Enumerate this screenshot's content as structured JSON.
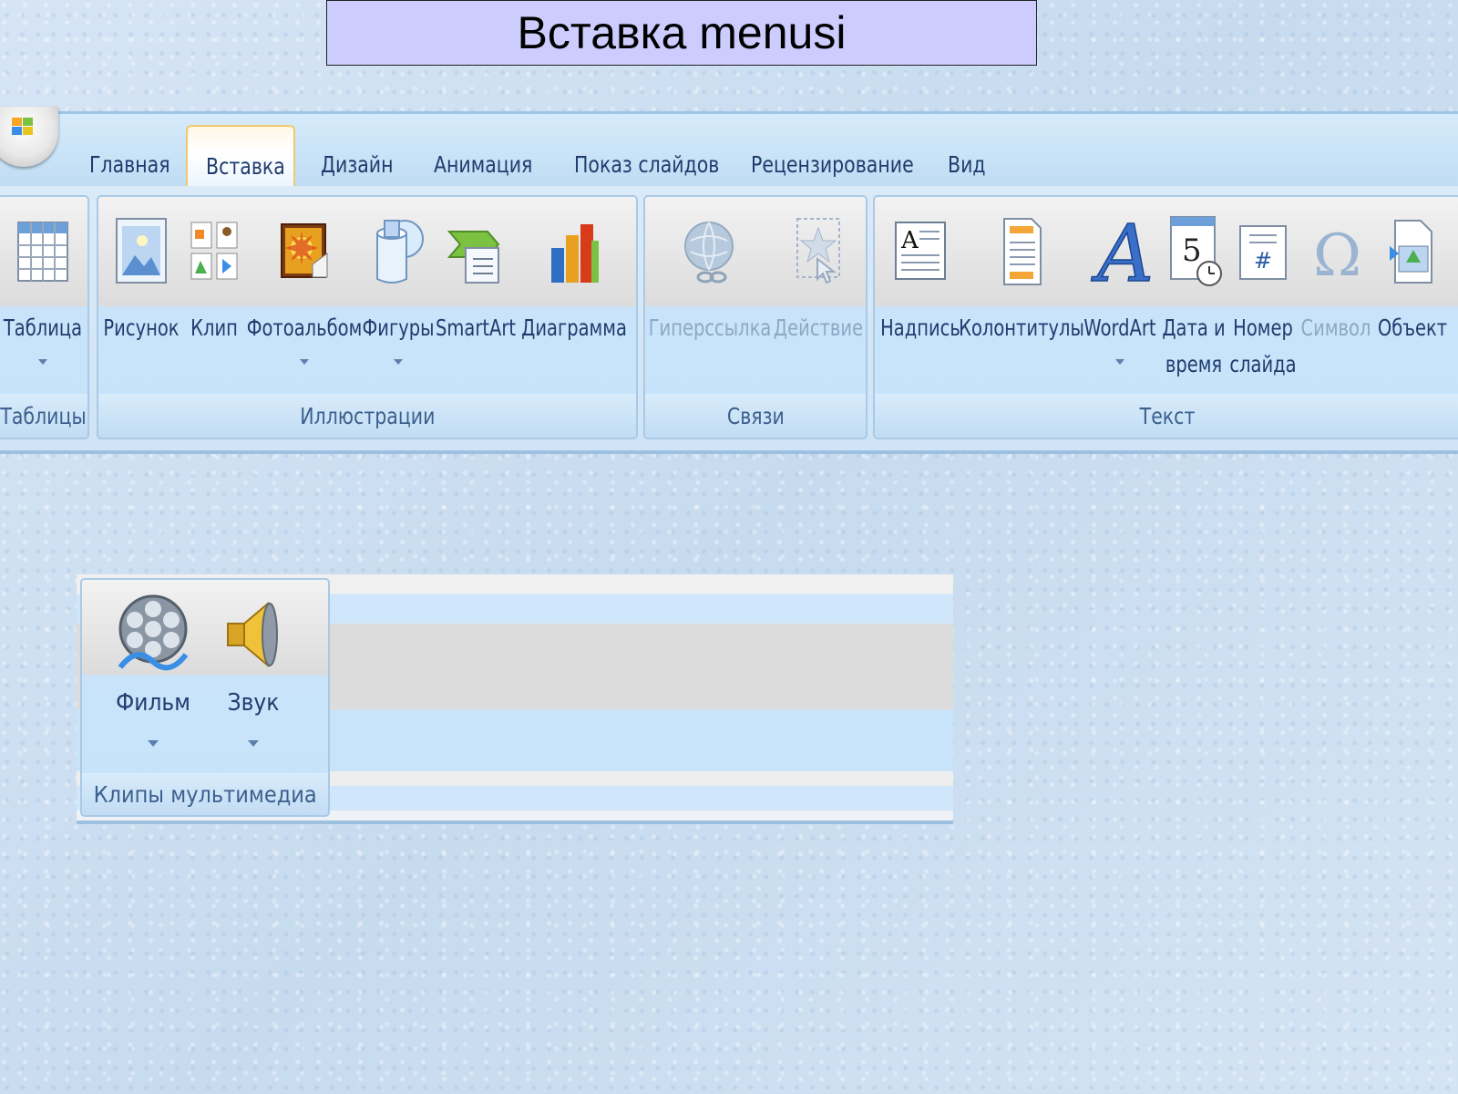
{
  "slide": {
    "title": "Вставка menusi"
  },
  "ribbon": {
    "tabs": [
      "Главная",
      "Вставка",
      "Дизайн",
      "Анимация",
      "Показ слайдов",
      "Рецензирование",
      "Вид"
    ],
    "active_tab": "Вставка",
    "groups": {
      "tables": {
        "label": "Таблицы",
        "buttons": [
          {
            "label": "Таблица",
            "icon": "table-icon",
            "has_dropdown": true
          }
        ]
      },
      "illustrations": {
        "label": "Иллюстрации",
        "buttons": [
          {
            "label": "Рисунок",
            "icon": "picture-icon",
            "has_dropdown": false
          },
          {
            "label": "Клип",
            "icon": "clipart-icon",
            "has_dropdown": false
          },
          {
            "label": "Фотоальбом",
            "icon": "photo-album-icon",
            "has_dropdown": true
          },
          {
            "label": "Фигуры",
            "icon": "shapes-icon",
            "has_dropdown": true
          },
          {
            "label": "SmartArt",
            "icon": "smartart-icon",
            "has_dropdown": false
          },
          {
            "label": "Диаграмма",
            "icon": "chart-icon",
            "has_dropdown": false
          }
        ]
      },
      "links": {
        "label": "Связи",
        "buttons": [
          {
            "label": "Гиперссылка",
            "icon": "hyperlink-icon",
            "disabled": true
          },
          {
            "label": "Действие",
            "icon": "action-icon",
            "disabled": true
          }
        ]
      },
      "text": {
        "label": "Текст",
        "buttons": [
          {
            "label": "Надпись",
            "icon": "textbox-icon"
          },
          {
            "label": "Колонтитулы",
            "icon": "header-footer-icon"
          },
          {
            "label": "WordArt",
            "icon": "wordart-icon",
            "has_dropdown": true
          },
          {
            "label_line1": "Дата и",
            "label_line2": "время",
            "icon": "date-time-icon"
          },
          {
            "label_line1": "Номер",
            "label_line2": "слайда",
            "icon": "slide-number-icon"
          },
          {
            "label": "Символ",
            "icon": "symbol-icon",
            "disabled": true
          },
          {
            "label": "Объект",
            "icon": "object-icon"
          }
        ]
      }
    }
  },
  "media_ribbon": {
    "group_label": "Клипы мультимедиа",
    "buttons": [
      {
        "label": "Фильм",
        "icon": "film-reel-icon",
        "has_dropdown": true
      },
      {
        "label": "Звук",
        "icon": "speaker-icon",
        "has_dropdown": true
      }
    ]
  },
  "colors": {
    "title_bg": "#ccccff",
    "ribbon_text": "#1f3c6e",
    "group_label_text": "#3b5f8e",
    "disabled_text": "#8ea7c4",
    "active_tab_border": "#f1c86a"
  }
}
